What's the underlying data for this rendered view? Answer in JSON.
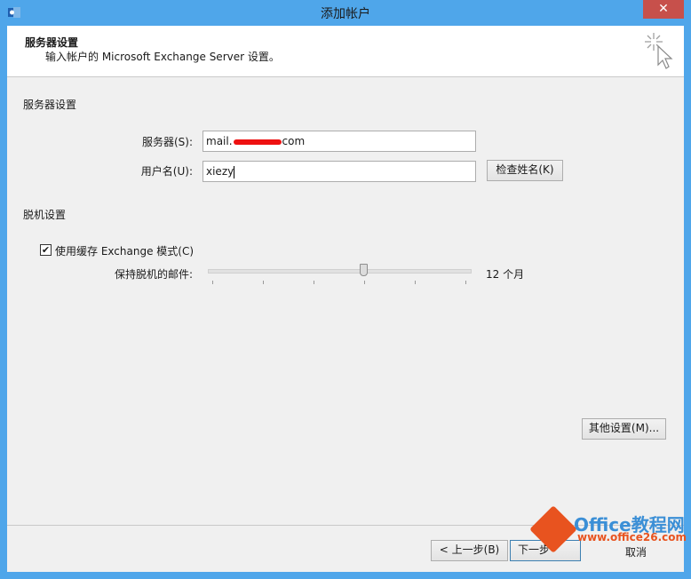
{
  "window": {
    "title": "添加帐户",
    "close_glyph": "✕"
  },
  "header": {
    "title": "服务器设置",
    "subtitle": "输入帐户的 Microsoft Exchange Server 设置。"
  },
  "server_section": {
    "label": "服务器设置",
    "server_label": "服务器(S):",
    "server_value_prefix": "mail.",
    "server_value_suffix": "com",
    "username_label": "用户名(U):",
    "username_value": "xiezy",
    "check_name_button": "检查姓名(K)"
  },
  "offline_section": {
    "label": "脱机设置",
    "cached_mode_checkbox": "使用缓存 Exchange 模式(C)",
    "cached_mode_checked": true,
    "check_glyph": "✔",
    "keep_mail_label": "保持脱机的邮件:",
    "keep_mail_value": "12 个月",
    "slider_level": 0.6
  },
  "more_settings_button": "其他设置(M)...",
  "footer": {
    "back_button": "< 上一步(B)",
    "next_button": "下一步",
    "cancel_partial": "取消"
  },
  "watermark": {
    "brand": "Office教程网",
    "url": "www.office26.com"
  },
  "colors": {
    "title_bar": "#4fa6ea",
    "close_button": "#c7504b",
    "dialog_bg": "#f0f0f0",
    "redaction": "#ee1111",
    "watermark_orange": "#e8531f",
    "watermark_blue": "#3b8fd6"
  }
}
